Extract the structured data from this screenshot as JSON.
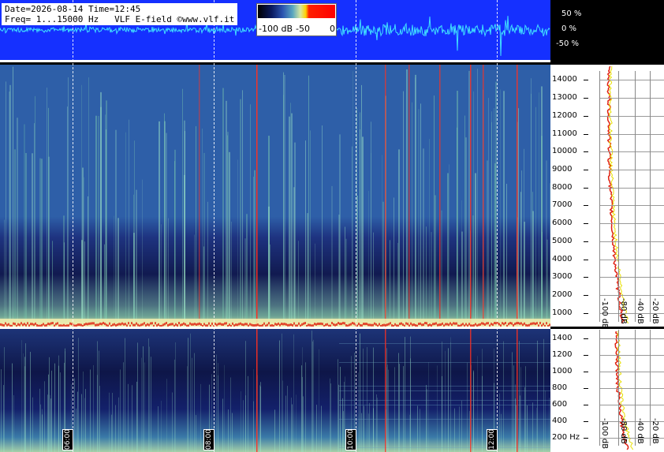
{
  "header": {
    "info_line1": "Date=2026-08-14 Time=12:45",
    "info_line2": "Freq= 1...15000 Hz   VLF E-field ©www.vlf.it"
  },
  "color_scale": {
    "labels": [
      "-100 dB",
      "-50",
      "0"
    ]
  },
  "waveform_scale": [
    "50 %",
    "0 %",
    "-50 %"
  ],
  "spectrogram_top": {
    "freq_ticks": [
      "14000",
      "13000",
      "12000",
      "11000",
      "10000",
      "9000",
      "8000",
      "7000",
      "6000",
      "5000",
      "4000",
      "3000",
      "2000",
      "1000"
    ],
    "db_labels": [
      "-100 dB",
      "-80 dB",
      "-40 dB",
      "-20 dB"
    ]
  },
  "spectrogram_bottom": {
    "freq_ticks": [
      "1400",
      "1200",
      "1000",
      "800",
      "600",
      "400",
      "200 Hz"
    ],
    "db_labels": [
      "-100 dB",
      "-80 dB",
      "-40 dB",
      "-20 dB"
    ]
  },
  "time_markers": [
    "06:00",
    "08:00",
    "10:00",
    "12:00"
  ],
  "colors": {
    "waveform_bg": "#1530ff",
    "trace": "#ffff00",
    "peak_trace": "#ff0000"
  }
}
